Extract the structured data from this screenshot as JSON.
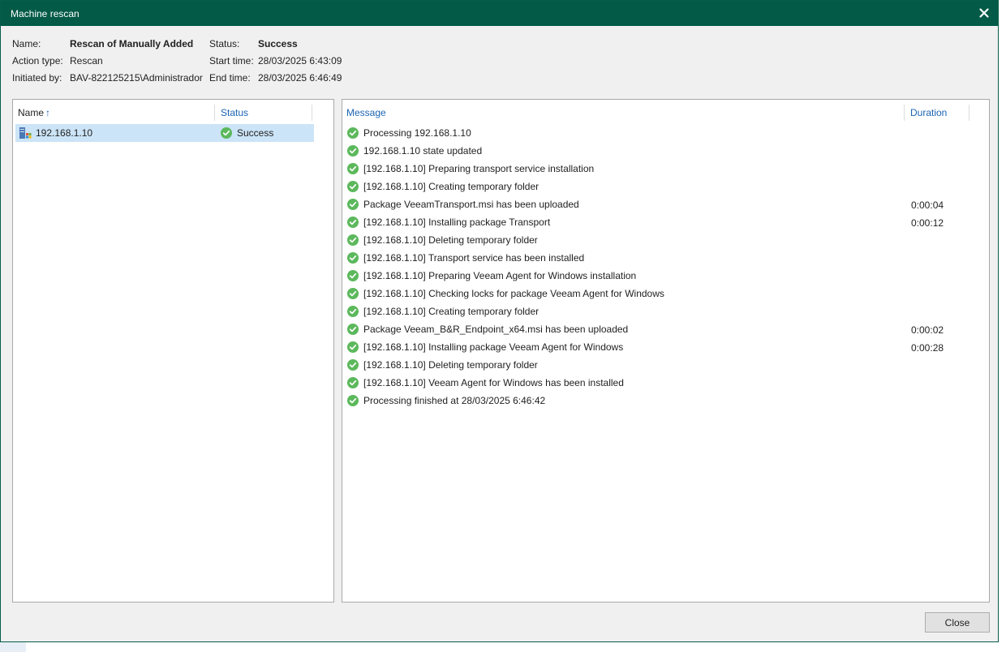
{
  "window": {
    "title": "Machine rescan"
  },
  "info": {
    "name_label": "Name:",
    "name_value": "Rescan of Manually Added",
    "action_label": "Action type:",
    "action_value": "Rescan",
    "initiated_label": "Initiated by:",
    "initiated_value": "BAV-822125215\\Administrador",
    "status_label": "Status:",
    "status_value": "Success",
    "start_label": "Start time:",
    "start_value": "28/03/2025 6:43:09",
    "end_label": "End time:",
    "end_value": "28/03/2025 6:46:49"
  },
  "left_table": {
    "col_name": "Name",
    "sort_arrow": "↑",
    "col_status": "Status",
    "rows": [
      {
        "name": "192.168.1.10",
        "status": "Success"
      }
    ]
  },
  "right_table": {
    "col_message": "Message",
    "col_duration": "Duration",
    "rows": [
      {
        "message": "Processing 192.168.1.10",
        "duration": ""
      },
      {
        "message": "192.168.1.10 state updated",
        "duration": ""
      },
      {
        "message": "[192.168.1.10] Preparing transport service installation",
        "duration": ""
      },
      {
        "message": "[192.168.1.10] Creating temporary folder",
        "duration": ""
      },
      {
        "message": "Package VeeamTransport.msi has been uploaded",
        "duration": "0:00:04"
      },
      {
        "message": "[192.168.1.10] Installing package Transport",
        "duration": "0:00:12"
      },
      {
        "message": "[192.168.1.10] Deleting temporary folder",
        "duration": ""
      },
      {
        "message": "[192.168.1.10] Transport service has been installed",
        "duration": ""
      },
      {
        "message": "[192.168.1.10] Preparing Veeam Agent for Windows installation",
        "duration": ""
      },
      {
        "message": "[192.168.1.10] Checking locks for package Veeam Agent for Windows",
        "duration": ""
      },
      {
        "message": "[192.168.1.10] Creating temporary folder",
        "duration": ""
      },
      {
        "message": "Package Veeam_B&R_Endpoint_x64.msi has been uploaded",
        "duration": "0:00:02"
      },
      {
        "message": "[192.168.1.10] Installing package Veeam Agent for Windows",
        "duration": "0:00:28"
      },
      {
        "message": "[192.168.1.10] Deleting temporary folder",
        "duration": ""
      },
      {
        "message": "[192.168.1.10] Veeam Agent for Windows has been installed",
        "duration": ""
      },
      {
        "message": "Processing finished at 28/03/2025 6:46:42",
        "duration": ""
      }
    ]
  },
  "buttons": {
    "close_label": "Close"
  },
  "colors": {
    "titlebar": "#025a47",
    "accent_blue": "#1b64b2",
    "success_green": "#5cb85c",
    "selection": "#cce4f7"
  },
  "icons": {
    "status": "success-check-icon",
    "machine": "windows-server-icon",
    "close": "close-icon"
  }
}
